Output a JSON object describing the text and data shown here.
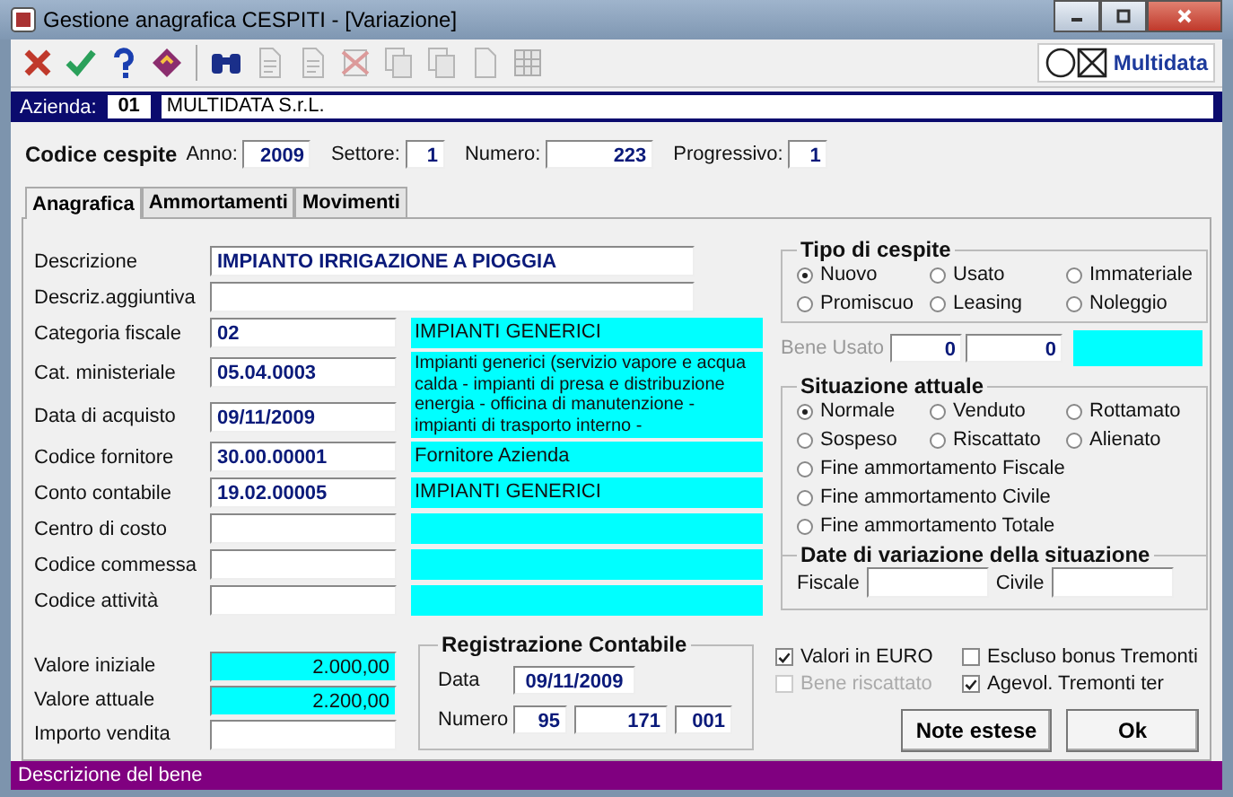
{
  "window": {
    "title": "Gestione anagrafica CESPITI - [Variazione]"
  },
  "toolbar": [
    {
      "kind": "cancel",
      "disabled": false
    },
    {
      "kind": "confirm",
      "disabled": false
    },
    {
      "kind": "help",
      "disabled": false
    },
    {
      "kind": "book",
      "disabled": false
    },
    {
      "kind": "search",
      "disabled": false
    },
    {
      "kind": "doc-in",
      "disabled": true
    },
    {
      "kind": "doc-out",
      "disabled": true
    },
    {
      "kind": "doc-delete",
      "disabled": true
    },
    {
      "kind": "copy",
      "disabled": true
    },
    {
      "kind": "paste",
      "disabled": true
    },
    {
      "kind": "blank",
      "disabled": true
    },
    {
      "kind": "grid",
      "disabled": true
    }
  ],
  "brand": "Multidata",
  "azienda": {
    "label": "Azienda:",
    "code": "01",
    "name": "MULTIDATA S.r.L."
  },
  "codice": {
    "title": "Codice cespite",
    "fields": [
      {
        "label": "Anno:",
        "value": "2009"
      },
      {
        "label": "Settore:",
        "value": "1"
      },
      {
        "label": "Numero:",
        "value": "223"
      },
      {
        "label": "Progressivo:",
        "value": "1"
      }
    ]
  },
  "tabs": [
    {
      "label": "Anagrafica",
      "selected": true
    },
    {
      "label": "Ammortamenti",
      "selected": false
    },
    {
      "label": "Movimenti",
      "selected": false
    }
  ],
  "form": [
    {
      "kind": "wide",
      "label": "Descrizione",
      "value": "IMPIANTO IRRIGAZIONE A PIOGGIA"
    },
    {
      "kind": "wide",
      "label": "Descriz.aggiuntiva"
    },
    {
      "kind": "coded",
      "label": "Categoria fiscale",
      "code": "02",
      "description": "IMPIANTI GENERICI"
    },
    {
      "kind": "tall",
      "label": "Cat. ministeriale",
      "code": "05.04.0003",
      "description": "Impianti generici (servizio vapore e acqua calda - impianti di presa e distribuzione energia - officina di manutenzione - impianti di trasporto interno -"
    },
    {
      "kind": "code",
      "label": "Data di acquisto",
      "code": "09/11/2009"
    },
    {
      "kind": "coded",
      "label": "Codice fornitore",
      "code": "30.00.00001",
      "description": "Fornitore Azienda"
    },
    {
      "kind": "coded",
      "label": "Conto contabile",
      "code": "19.02.00005",
      "description": "IMPIANTI GENERICI"
    },
    {
      "kind": "coded",
      "label": "Centro di costo"
    },
    {
      "kind": "coded",
      "label": "Codice commessa"
    },
    {
      "kind": "coded",
      "label": "Codice attività"
    }
  ],
  "tipo": {
    "title": "Tipo di cespite",
    "options": [
      {
        "label": "Nuovo",
        "selected": true
      },
      {
        "label": "Usato",
        "selected": false
      },
      {
        "label": "Immateriale",
        "selected": false
      },
      {
        "label": "Promiscuo",
        "selected": false
      },
      {
        "label": "Leasing",
        "selected": false
      },
      {
        "label": "Noleggio",
        "selected": false
      }
    ]
  },
  "bene_usato": {
    "label": "Bene Usato",
    "disabled": true,
    "values": [
      "0",
      "0"
    ]
  },
  "situazione": {
    "title": "Situazione attuale",
    "options": [
      {
        "label": "Normale",
        "selected": true
      },
      {
        "label": "Venduto",
        "selected": false
      },
      {
        "label": "Rottamato",
        "selected": false
      },
      {
        "label": "Sospeso",
        "selected": false
      },
      {
        "label": "Riscattato",
        "selected": false
      },
      {
        "label": "Alienato",
        "selected": false
      }
    ],
    "long_options": [
      {
        "label": "Fine ammortamento Fiscale",
        "selected": false
      },
      {
        "label": "Fine ammortamento Civile",
        "selected": false
      },
      {
        "label": "Fine ammortamento Totale",
        "selected": false
      }
    ]
  },
  "date_variazione": {
    "title": "Date di variazione della situazione",
    "fields": [
      {
        "label": "Fiscale"
      },
      {
        "label": "Civile"
      }
    ]
  },
  "valori": [
    {
      "label": "Valore iniziale",
      "value": "2.000,00",
      "kind": "computed"
    },
    {
      "label": "Valore attuale",
      "value": "2.200,00",
      "kind": "computed"
    },
    {
      "label": "Importo vendita",
      "kind": "input"
    }
  ],
  "registrazione": {
    "title": "Registrazione Contabile",
    "data_label": "Data",
    "data": "09/11/2009",
    "numero_label": "Numero",
    "numero": [
      "95",
      "171",
      "001"
    ]
  },
  "checks": [
    {
      "label": "Valori in EURO",
      "checked": true,
      "disabled": false
    },
    {
      "label": "Escluso bonus Tremonti",
      "checked": false,
      "disabled": false
    },
    {
      "label": "Bene riscattato",
      "checked": false,
      "disabled": true
    },
    {
      "label": "Agevol. Tremonti ter",
      "checked": true,
      "disabled": false
    }
  ],
  "buttons": [
    "Note estese",
    "Ok"
  ],
  "status_bar": "Descrizione del bene"
}
